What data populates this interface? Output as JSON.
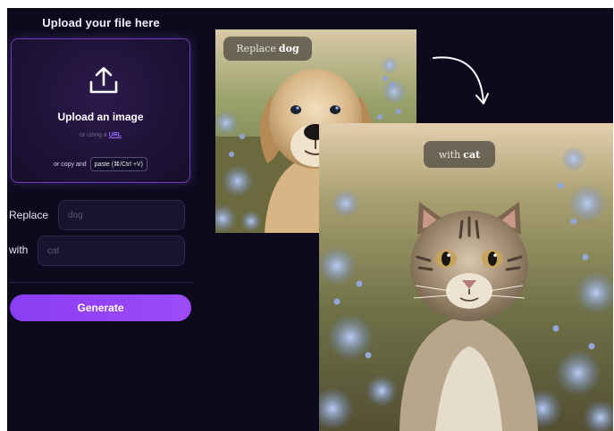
{
  "upload": {
    "title": "Upload your file here",
    "dropzone_title": "Upload an image",
    "url_prefix": "or using a",
    "url_link": "URL",
    "paste_prefix": "or copy and",
    "paste_button": "paste (⌘/Ctrl +V)"
  },
  "form": {
    "replace_label": "Replace",
    "replace_placeholder": "dog",
    "with_label": "with",
    "with_placeholder": "cat",
    "generate_label": "Generate"
  },
  "examples": {
    "before_caption_word": "Replace",
    "before_caption_target": "dog",
    "after_caption_word": "with",
    "after_caption_target": "cat"
  },
  "colors": {
    "background": "#0d0a1e",
    "accent": "#8a3df2",
    "dropzone_border": "#6b3fb0"
  },
  "icons": {
    "upload": "upload-arrow-icon",
    "arrow": "curved-arrow-icon"
  }
}
